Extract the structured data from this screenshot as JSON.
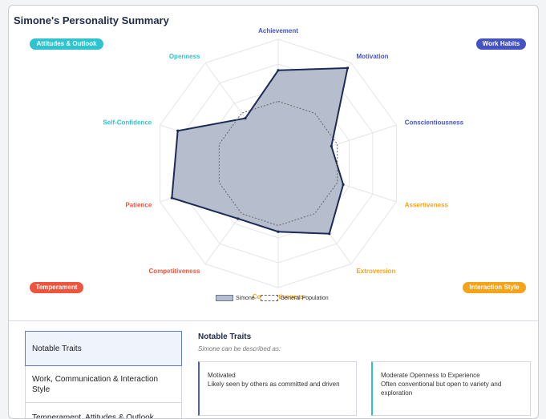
{
  "summary": {
    "title": "Simone's Personality Summary"
  },
  "categories": {
    "attitudes": {
      "label": "Attitudes & Outlook",
      "color": "#2ec4cf"
    },
    "work": {
      "label": "Work Habits",
      "color": "#4452c4"
    },
    "temperament": {
      "label": "Temperament",
      "color": "#f0543c"
    },
    "interaction": {
      "label": "Interaction Style",
      "color": "#f7a318"
    }
  },
  "chart_data": {
    "type": "radar",
    "categories": [
      "Achievement",
      "Motivation",
      "Conscientiousness",
      "Assertiveness",
      "Extroversion",
      "Cooperativeness",
      "Competitiveness",
      "Patience",
      "Self-Confidence",
      "Openness"
    ],
    "category_groups": [
      "Work Habits",
      "Work Habits",
      "Work Habits",
      "Interaction Style",
      "Interaction Style",
      "Interaction Style",
      "Temperament",
      "Temperament",
      "Attitudes & Outlook",
      "Attitudes & Outlook"
    ],
    "rlim": [
      0,
      1
    ],
    "series": [
      {
        "name": "Simone",
        "values": [
          0.75,
          0.95,
          0.45,
          0.55,
          0.7,
          0.55,
          0.55,
          0.9,
          0.85,
          0.45
        ],
        "fill": "#b6bdcc",
        "stroke": "#1c2b57"
      },
      {
        "name": "General Population",
        "values": [
          0.5,
          0.5,
          0.5,
          0.5,
          0.5,
          0.5,
          0.5,
          0.5,
          0.5,
          0.5
        ],
        "stroke": "#666666",
        "dashed": true
      }
    ],
    "grid": true,
    "legend": "bottom-center"
  },
  "nav": {
    "items": [
      {
        "label": "Notable Traits"
      },
      {
        "label": "Work, Communication & Interaction Style"
      },
      {
        "label": "Temperament, Attitudes & Outlook"
      }
    ]
  },
  "traits": {
    "title": "Notable Traits",
    "subtitle": "Simone can be described as:",
    "cards": [
      {
        "name": "Motivated",
        "description": "Likely seen by others as committed and driven"
      },
      {
        "name": "Moderate Openness to Experience",
        "description": "Often conventional but open to variety and exploration"
      }
    ]
  }
}
